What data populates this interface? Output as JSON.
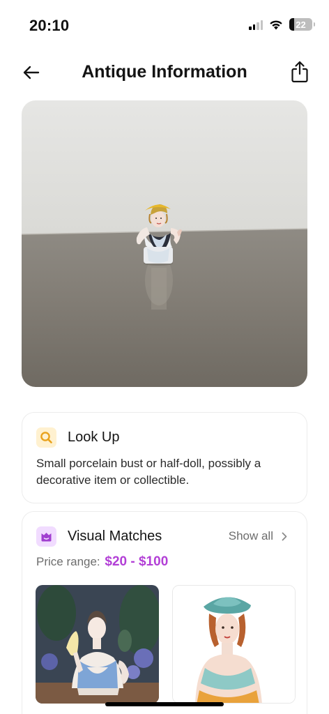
{
  "status_bar": {
    "time": "20:10",
    "battery": "22",
    "battery_level": 0.22
  },
  "nav": {
    "title": "Antique Information"
  },
  "lookup": {
    "title": "Look Up",
    "description": "Small porcelain bust or half-doll, possibly a decorative item or collectible."
  },
  "matches": {
    "title": "Visual Matches",
    "show_all": "Show all",
    "price_label": "Price range:",
    "price_value": "$20 - $100"
  },
  "colors": {
    "accent": "#b23fd6",
    "lookup_icon_bg": "#fff1d0",
    "lookup_icon": "#e9a21c",
    "matches_icon_bg": "#f1dcff",
    "matches_icon": "#a13fd0"
  },
  "icons": [
    "back-arrow-icon",
    "share-icon",
    "search-icon",
    "bust-icon",
    "chevron-right-icon"
  ]
}
